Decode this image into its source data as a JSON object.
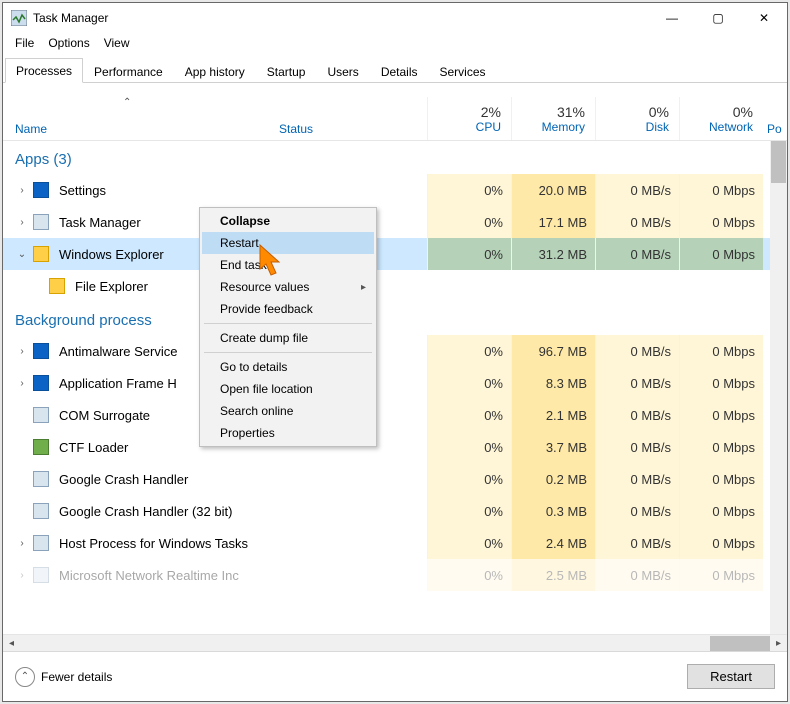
{
  "window": {
    "title": "Task Manager"
  },
  "win_controls": {
    "min": "—",
    "max": "▢",
    "close": "✕"
  },
  "menu": {
    "file": "File",
    "options": "Options",
    "view": "View"
  },
  "tabs": {
    "processes": "Processes",
    "performance": "Performance",
    "app_history": "App history",
    "startup": "Startup",
    "users": "Users",
    "details": "Details",
    "services": "Services"
  },
  "columns": {
    "name": "Name",
    "status": "Status",
    "cpu_pct": "2%",
    "cpu": "CPU",
    "mem_pct": "31%",
    "mem": "Memory",
    "disk_pct": "0%",
    "disk": "Disk",
    "net_pct": "0%",
    "net": "Network",
    "power_partial": "Po"
  },
  "groups": {
    "apps": "Apps (3)",
    "bg": "Background process"
  },
  "rows": {
    "settings": {
      "label": "Settings",
      "cpu": "0%",
      "mem": "20.0 MB",
      "disk": "0 MB/s",
      "net": "0 Mbps"
    },
    "taskmgr": {
      "label": "Task Manager",
      "cpu": "0%",
      "mem": "17.1 MB",
      "disk": "0 MB/s",
      "net": "0 Mbps"
    },
    "explorer": {
      "label": "Windows Explorer",
      "cpu": "0%",
      "mem": "31.2 MB",
      "disk": "0 MB/s",
      "net": "0 Mbps"
    },
    "fileexp": {
      "label": "File Explorer"
    },
    "antimalware": {
      "label": "Antimalware Service",
      "cpu": "0%",
      "mem": "96.7 MB",
      "disk": "0 MB/s",
      "net": "0 Mbps"
    },
    "appframe": {
      "label": "Application Frame H",
      "cpu": "0%",
      "mem": "8.3 MB",
      "disk": "0 MB/s",
      "net": "0 Mbps"
    },
    "comsurr": {
      "label": "COM Surrogate",
      "cpu": "0%",
      "mem": "2.1 MB",
      "disk": "0 MB/s",
      "net": "0 Mbps"
    },
    "ctf": {
      "label": "CTF Loader",
      "cpu": "0%",
      "mem": "3.7 MB",
      "disk": "0 MB/s",
      "net": "0 Mbps"
    },
    "gcrash": {
      "label": "Google Crash Handler",
      "cpu": "0%",
      "mem": "0.2 MB",
      "disk": "0 MB/s",
      "net": "0 Mbps"
    },
    "gcrash32": {
      "label": "Google Crash Handler (32 bit)",
      "cpu": "0%",
      "mem": "0.3 MB",
      "disk": "0 MB/s",
      "net": "0 Mbps"
    },
    "hostproc": {
      "label": "Host Process for Windows Tasks",
      "cpu": "0%",
      "mem": "2.4 MB",
      "disk": "0 MB/s",
      "net": "0 Mbps"
    },
    "msnet": {
      "label": "Microsoft Network Realtime Inc",
      "cpu": "0%",
      "mem": "2.5 MB",
      "disk": "0 MB/s",
      "net": "0 Mbps"
    }
  },
  "ctx": {
    "collapse": "Collapse",
    "restart": "Restart",
    "end": "End task",
    "res": "Resource values",
    "feedback": "Provide feedback",
    "dump": "Create dump file",
    "details": "Go to details",
    "open": "Open file location",
    "search": "Search online",
    "props": "Properties"
  },
  "footer": {
    "fewer": "Fewer details",
    "restart": "Restart"
  }
}
